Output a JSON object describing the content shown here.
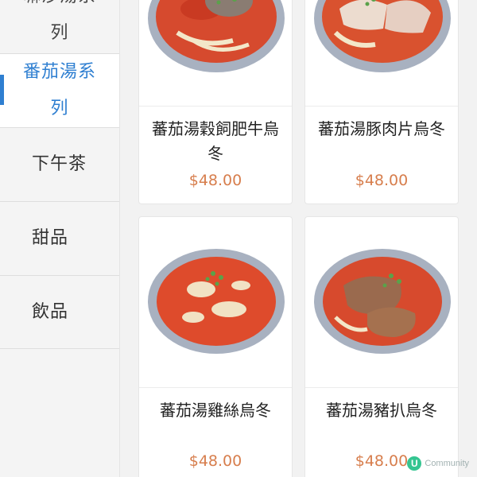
{
  "sidebar": {
    "items": [
      {
        "label": "嘛沙湯系列",
        "active": false
      },
      {
        "label": "番茄湯系列",
        "active": true
      },
      {
        "label": "下午茶",
        "active": false
      },
      {
        "label": "甜品",
        "active": false
      },
      {
        "label": "飲品",
        "active": false
      }
    ]
  },
  "products": [
    {
      "name": "蕃茄湯穀飼肥牛烏冬",
      "price": "$48.00",
      "image": "tomato-soup-beef-udon-photo"
    },
    {
      "name": "蕃茄湯豚肉片烏冬",
      "price": "$48.00",
      "image": "tomato-soup-pork-slice-udon-photo"
    },
    {
      "name": "蕃茄湯雞絲烏冬",
      "price": "$48.00",
      "image": "tomato-soup-shredded-chicken-udon-photo"
    },
    {
      "name": "蕃茄湯豬扒烏冬",
      "price": "$48.00",
      "image": "tomato-soup-pork-chop-udon-photo"
    }
  ],
  "watermark": {
    "logo": "U",
    "text": "Community"
  },
  "colors": {
    "accent": "#2f7fd1",
    "price": "#d77e4d",
    "sidebar_bg": "#f4f4f4",
    "page_bg": "#f2f2f2",
    "soup": "#d9442a",
    "bowl": "#9aa5b6"
  }
}
